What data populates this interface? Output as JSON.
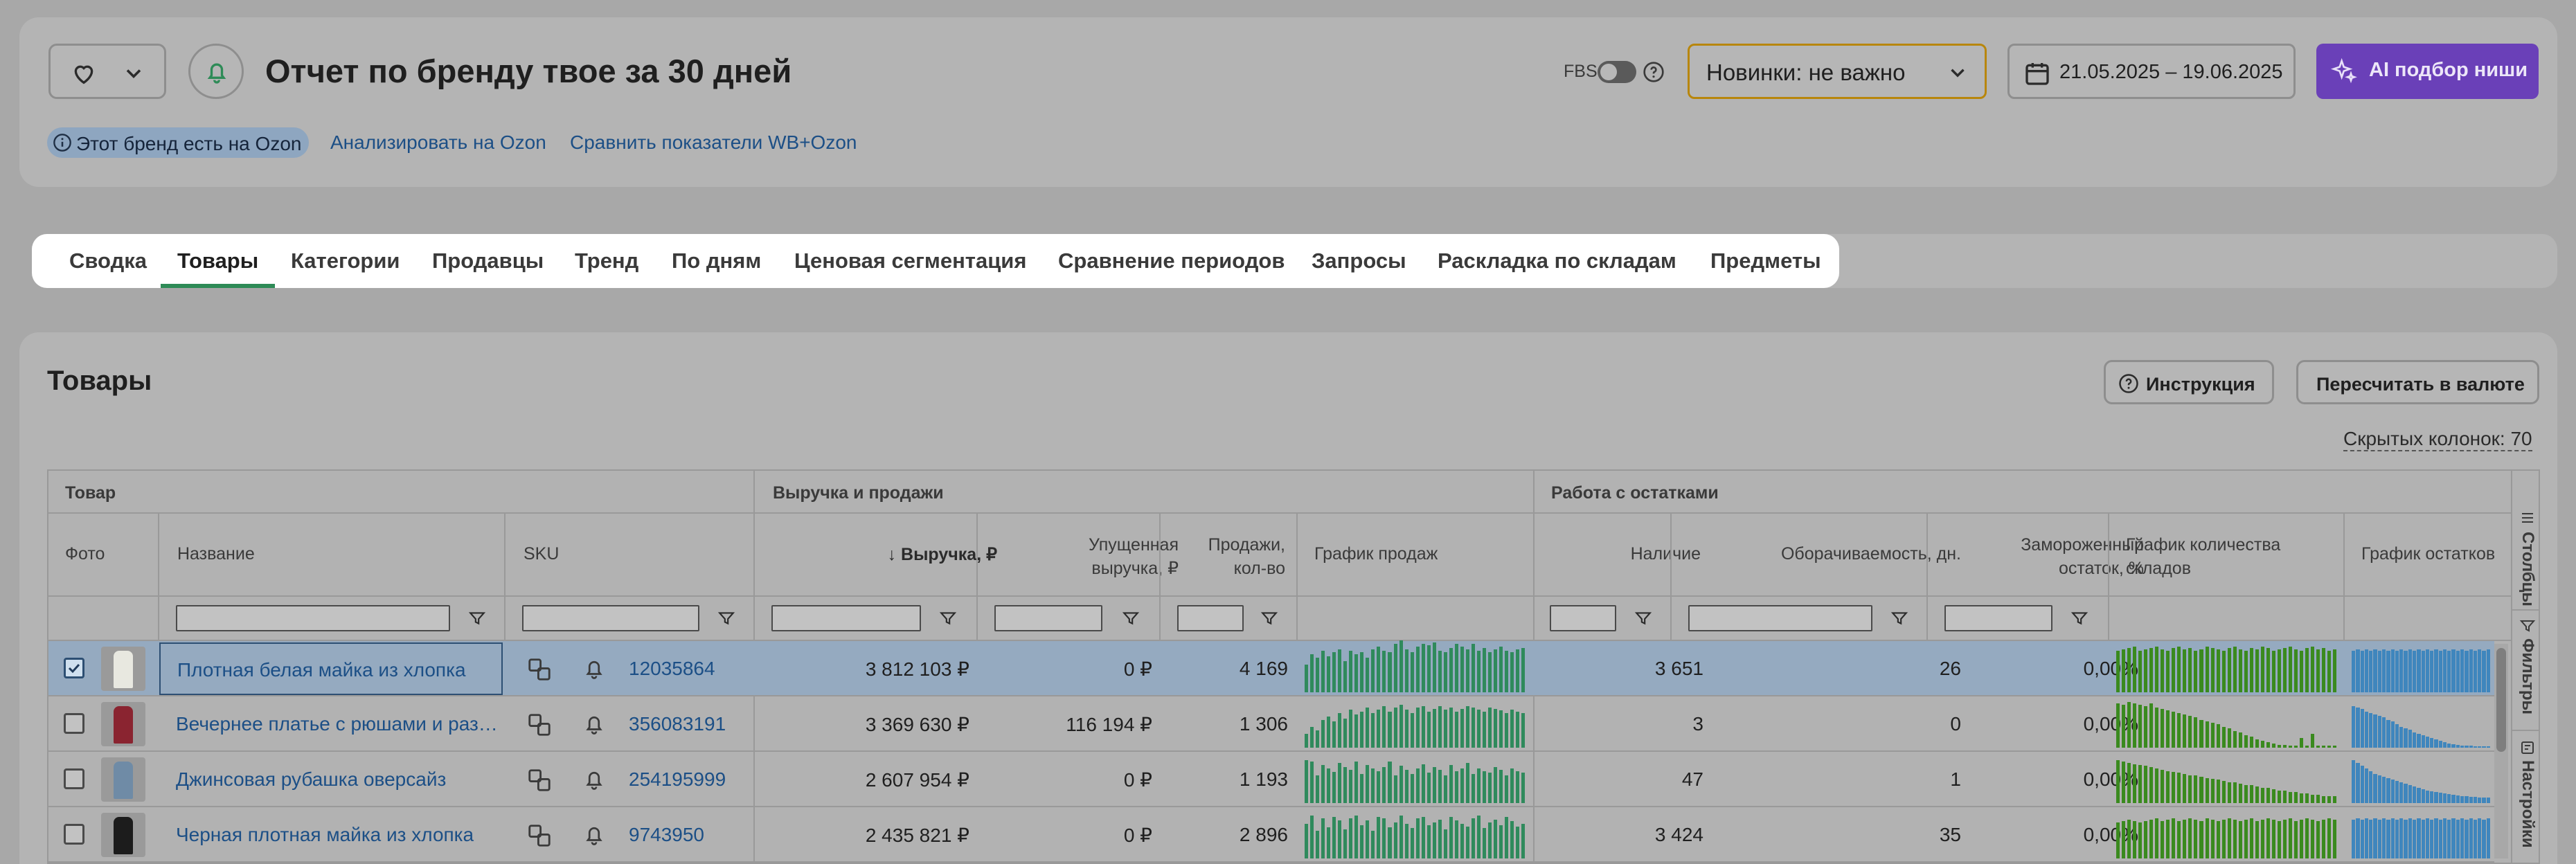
{
  "header": {
    "title": "Отчет по бренду твое за 30 дней",
    "fbs_label": "FBS",
    "novelty_select": "Новинки: не важно",
    "date_range": "21.05.2025 – 19.06.2025",
    "ai_button": "AI подбор ниши",
    "ozon_badge": "Этот бренд есть на Ozon",
    "analyze_link": "Анализировать на Ozon",
    "compare_link": "Сравнить показатели WB+Ozon"
  },
  "tabs": [
    "Сводка",
    "Товары",
    "Категории",
    "Продавцы",
    "Тренд",
    "По дням",
    "Ценовая сегментация",
    "Сравнение периодов",
    "Запросы",
    "Раскладка по складам",
    "Предметы"
  ],
  "active_tab": "Товары",
  "section": {
    "title": "Товары",
    "instruction_button": "Инструкция",
    "recalc_button": "Пересчитать в валюте",
    "hidden_columns": "Скрытых колонок: 70"
  },
  "table": {
    "groups": {
      "product": "Товар",
      "revenue": "Выручка и продажи",
      "stock": "Работа с остатками"
    },
    "columns": {
      "photo": "Фото",
      "name": "Название",
      "sku": "SKU",
      "revenue": "↓ Выручка, ₽",
      "lost_revenue_1": "Упущенная",
      "lost_revenue_2": "выручка, ₽",
      "sales_1": "Продажи,",
      "sales_2": "кол-во",
      "sales_chart": "График продаж",
      "stock": "Наличие",
      "turnover": "Оборачиваемость, дн.",
      "frozen_1": "Замороженный",
      "frozen_2": "остаток, %",
      "wh_chart_1": "График количества",
      "wh_chart_2": "складов",
      "stock_chart": "График остатков"
    },
    "rows": [
      {
        "checked": true,
        "thumb_color": "#e8e8e0",
        "name": "Плотная белая майка из хлопка",
        "sku": "12035864",
        "revenue": "3 812 103 ₽",
        "lost": "0 ₽",
        "sales": "4 169",
        "stock": "3 651",
        "turnover": "26",
        "frozen": "0,00%",
        "sales_bars": [
          40,
          55,
          50,
          60,
          52,
          58,
          62,
          45,
          60,
          55,
          58,
          50,
          62,
          66,
          60,
          58,
          70,
          75,
          62,
          58,
          66,
          70,
          68,
          72,
          60,
          58,
          64,
          70,
          66,
          62,
          70,
          60,
          64,
          58,
          62,
          66,
          60,
          58,
          62,
          64
        ],
        "wh_bars": [
          60,
          62,
          64,
          66,
          60,
          62,
          64,
          66,
          62,
          60,
          64,
          66,
          62,
          64,
          60,
          62,
          66,
          64,
          62,
          60,
          64,
          66,
          62,
          60,
          64,
          62,
          66,
          64,
          60,
          62,
          64,
          66,
          62,
          60,
          64,
          66,
          62,
          64,
          60,
          62
        ],
        "stock_bars": [
          60,
          62,
          60,
          62,
          60,
          62,
          60,
          62,
          60,
          62,
          60,
          62,
          60,
          62,
          60,
          62,
          60,
          62,
          60,
          62,
          60,
          62,
          60,
          62,
          60,
          62,
          60,
          62,
          60,
          62,
          60,
          62
        ]
      },
      {
        "checked": false,
        "thumb_color": "#8a2430",
        "name": "Вечернее платье с рюшами и раз…",
        "sku": "356083191",
        "revenue": "3 369 630 ₽",
        "lost": "116 194 ₽",
        "sales": "1 306",
        "stock": "3",
        "turnover": "0",
        "frozen": "0,00%",
        "sales_bars": [
          20,
          30,
          25,
          40,
          45,
          38,
          50,
          42,
          55,
          48,
          52,
          58,
          50,
          55,
          60,
          52,
          58,
          62,
          55,
          50,
          58,
          60,
          52,
          56,
          60,
          55,
          58,
          52,
          56,
          60,
          58,
          55,
          52,
          58,
          56,
          54,
          50,
          55,
          52,
          50
        ],
        "wh_bars": [
          64,
          62,
          66,
          64,
          62,
          60,
          64,
          58,
          56,
          54,
          52,
          50,
          48,
          46,
          44,
          40,
          38,
          36,
          34,
          30,
          28,
          24,
          22,
          18,
          16,
          12,
          10,
          8,
          6,
          4,
          4,
          3,
          3,
          14,
          3,
          20,
          3,
          3,
          3,
          3
        ],
        "stock_bars": [
          60,
          58,
          56,
          52,
          50,
          48,
          46,
          44,
          40,
          38,
          34,
          30,
          28,
          26,
          22,
          20,
          18,
          16,
          14,
          12,
          10,
          8,
          6,
          5,
          4,
          3,
          3,
          3,
          2,
          2,
          2,
          2
        ]
      },
      {
        "checked": false,
        "thumb_color": "#6f8ba6",
        "name": "Джинсовая рубашка оверсайз",
        "sku": "254195999",
        "revenue": "2 607 954 ₽",
        "lost": "0 ₽",
        "sales": "1 193",
        "stock": "47",
        "turnover": "1",
        "frozen": "0,00%",
        "sales_bars": [
          62,
          60,
          40,
          55,
          50,
          45,
          58,
          52,
          48,
          60,
          42,
          55,
          50,
          46,
          52,
          60,
          40,
          54,
          48,
          42,
          50,
          56,
          44,
          52,
          48,
          40,
          55,
          46,
          50,
          58,
          42,
          50,
          46,
          44,
          52,
          48,
          40,
          50,
          46,
          44
        ],
        "wh_bars": [
          62,
          60,
          58,
          56,
          55,
          54,
          52,
          50,
          48,
          46,
          45,
          44,
          42,
          40,
          40,
          38,
          36,
          35,
          34,
          32,
          30,
          30,
          28,
          26,
          26,
          24,
          22,
          22,
          20,
          18,
          18,
          16,
          16,
          14,
          14,
          12,
          12,
          10,
          10,
          10
        ],
        "stock_bars": [
          62,
          58,
          54,
          50,
          46,
          42,
          40,
          38,
          36,
          34,
          32,
          30,
          28,
          26,
          24,
          22,
          20,
          18,
          17,
          16,
          15,
          14,
          13,
          12,
          11,
          10,
          10,
          9,
          9,
          8,
          8,
          8
        ]
      },
      {
        "checked": false,
        "thumb_color": "#1c1c1c",
        "name": "Черная плотная майка из хлопка",
        "sku": "9743950",
        "revenue": "2 435 821 ₽",
        "lost": "0 ₽",
        "sales": "2 896",
        "stock": "3 424",
        "turnover": "35",
        "frozen": "0,00%",
        "sales_bars": [
          50,
          62,
          40,
          58,
          45,
          60,
          55,
          42,
          58,
          62,
          48,
          55,
          40,
          60,
          58,
          45,
          52,
          62,
          50,
          44,
          58,
          60,
          48,
          52,
          56,
          42,
          60,
          55,
          50,
          46,
          58,
          62,
          44,
          52,
          56,
          48,
          60,
          54,
          46,
          50
        ],
        "wh_bars": [
          52,
          54,
          56,
          54,
          52,
          54,
          56,
          58,
          54,
          56,
          58,
          54,
          56,
          58,
          56,
          54,
          58,
          56,
          54,
          56,
          58,
          56,
          54,
          56,
          58,
          54,
          56,
          58,
          56,
          54,
          56,
          58,
          54,
          56,
          58,
          56,
          54,
          56,
          58,
          56
        ],
        "stock_bars": [
          56,
          58,
          56,
          58,
          56,
          58,
          56,
          58,
          56,
          58,
          56,
          58,
          56,
          58,
          56,
          58,
          56,
          58,
          56,
          58,
          56,
          58,
          56,
          58,
          56,
          58,
          56,
          58,
          56,
          58,
          56,
          58
        ]
      }
    ]
  },
  "side_tabs": [
    "Столбцы",
    "Фильтры",
    "Настройки"
  ],
  "colors": {
    "accent_purple": "#6a40b8",
    "link_blue": "#1c4f86",
    "sales_green": "#2f8a5c",
    "wh_green": "#3a8a1e",
    "stock_blue": "#3f86bd",
    "tab_green": "#2e8b57"
  }
}
